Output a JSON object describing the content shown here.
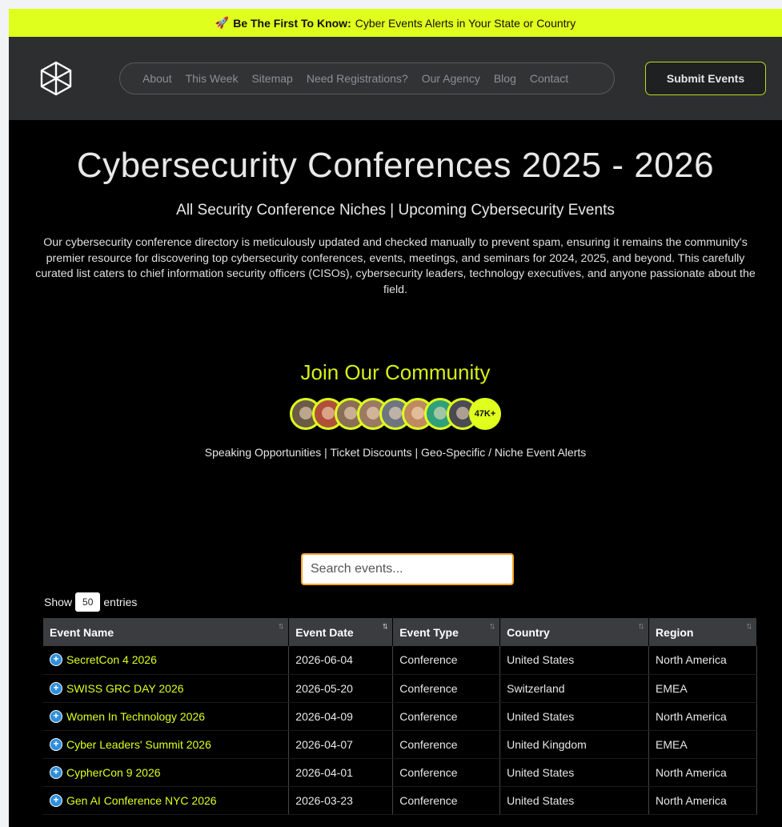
{
  "alert": {
    "emoji": "🚀",
    "bold": "Be The First To Know:",
    "text": "Cyber Events Alerts in Your State or Country"
  },
  "nav": {
    "items": [
      "About",
      "This Week",
      "Sitemap",
      "Need Registrations?",
      "Our Agency",
      "Blog",
      "Contact"
    ],
    "submit_label": "Submit Events"
  },
  "hero": {
    "title": "Cybersecurity Conferences 2025 - 2026",
    "subtitle": "All Security Conference Niches | Upcoming Cybersecurity Events",
    "description": "Our cybersecurity conference directory is meticulously updated and checked manually to prevent spam, ensuring it remains the community's premier resource for discovering top cybersecurity conferences, events, meetings, and seminars for 2024, 2025, and beyond. This carefully curated list caters to chief information security officers (CISOs), cybersecurity leaders, technology executives, and anyone passionate about the field."
  },
  "community": {
    "title": "Join Our Community",
    "member_count": "47K+",
    "avatar_colors": [
      "#6b5a45",
      "#b0503a",
      "#8a6e55",
      "#9a7a62",
      "#6e7580",
      "#c08a60",
      "#2fa07a",
      "#4a4a52"
    ],
    "perks": "Speaking Opportunities | Ticket Discounts | Geo-Specific / Niche Event Alerts"
  },
  "search": {
    "placeholder": "Search events..."
  },
  "length": {
    "show": "Show",
    "value": "50",
    "entries": "entries"
  },
  "table": {
    "columns": [
      "Event Name",
      "Event Date",
      "Event Type",
      "Country",
      "Region"
    ],
    "rows": [
      [
        "SecretCon 4 2026",
        "2026-06-04",
        "Conference",
        "United States",
        "North America"
      ],
      [
        "SWISS GRC DAY 2026",
        "2026-05-20",
        "Conference",
        "Switzerland",
        "EMEA"
      ],
      [
        "Women In Technology 2026",
        "2026-04-09",
        "Conference",
        "United States",
        "North America"
      ],
      [
        "Cyber Leaders' Summit 2026",
        "2026-04-07",
        "Conference",
        "United Kingdom",
        "EMEA"
      ],
      [
        "CypherCon 9 2026",
        "2026-04-01",
        "Conference",
        "United States",
        "North America"
      ],
      [
        "Gen AI Conference NYC 2026",
        "2026-03-23",
        "Conference",
        "United States",
        "North America"
      ]
    ]
  }
}
